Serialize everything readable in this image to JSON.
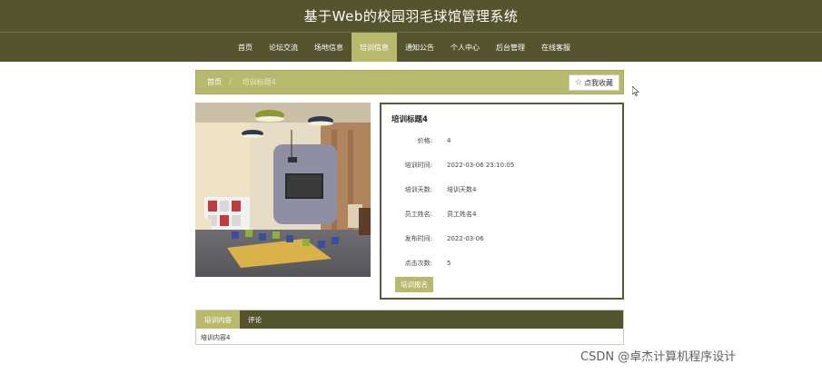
{
  "header": {
    "title": "基于Web的校园羽毛球馆管理系统"
  },
  "nav": {
    "items": [
      {
        "label": "首页",
        "active": false
      },
      {
        "label": "论坛交流",
        "active": false
      },
      {
        "label": "场地信息",
        "active": false
      },
      {
        "label": "培训信息",
        "active": true
      },
      {
        "label": "通知公告",
        "active": false
      },
      {
        "label": "个人中心",
        "active": false
      },
      {
        "label": "后台管理",
        "active": false
      },
      {
        "label": "在线客服",
        "active": false
      }
    ]
  },
  "breadcrumb": {
    "home": "首页",
    "separator": "/",
    "current": "培训标题4",
    "favorite_label": "点我收藏"
  },
  "detail": {
    "title": "培训标题4",
    "fields": [
      {
        "label": "价格:",
        "value": "4"
      },
      {
        "label": "培训时间:",
        "value": "2022-03-06 23:10:05"
      },
      {
        "label": "培训天数:",
        "value": "培训天数4"
      },
      {
        "label": "员工姓名:",
        "value": "员工姓名4"
      },
      {
        "label": "发布时间:",
        "value": "2022-03-06"
      },
      {
        "label": "点击次数:",
        "value": "5"
      }
    ],
    "signup_label": "培训报名"
  },
  "tabs": {
    "items": [
      {
        "label": "培训内容",
        "active": true
      },
      {
        "label": "评论",
        "active": false
      }
    ],
    "content": "培训内容4"
  },
  "watermark": "CSDN @卓杰计算机程序设计",
  "colors": {
    "primary_dark": "#54542f",
    "accent": "#b9b96e"
  }
}
